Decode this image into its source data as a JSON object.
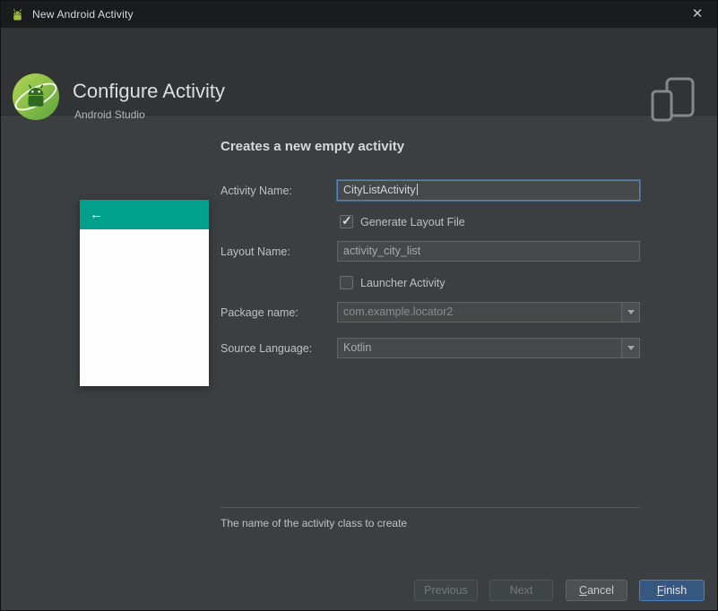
{
  "window": {
    "title": "New Android Activity"
  },
  "header": {
    "title": "Configure Activity",
    "subtitle": "Android Studio"
  },
  "form": {
    "heading": "Creates a new empty activity",
    "activity_name": {
      "label": "Activity Name:",
      "value": "CityListActivity"
    },
    "generate_layout": {
      "label": "Generate Layout File",
      "checked": true
    },
    "layout_name": {
      "label": "Layout Name:",
      "value": "activity_city_list"
    },
    "launcher": {
      "label": "Launcher Activity",
      "checked": false
    },
    "package_name": {
      "label": "Package name:",
      "value": "com.example.locator2"
    },
    "source_language": {
      "label": "Source Language:",
      "value": "Kotlin"
    }
  },
  "hint": "The name of the activity class to create",
  "buttons": {
    "previous": "Previous",
    "next": "Next",
    "cancel": {
      "mnemonic": "C",
      "rest": "ancel"
    },
    "finish": {
      "mnemonic": "F",
      "rest": "inish"
    }
  },
  "icons": {
    "close": "✕",
    "back_arrow": "←",
    "check": "✓"
  },
  "colors": {
    "titlebar": "#191b1c",
    "header_band": "#313335",
    "body": "#3c3f41",
    "field_bg": "#45494a",
    "focus_border": "#4a88c7",
    "preview_header_teal": "#00a08c",
    "primary_button": "#365880"
  }
}
